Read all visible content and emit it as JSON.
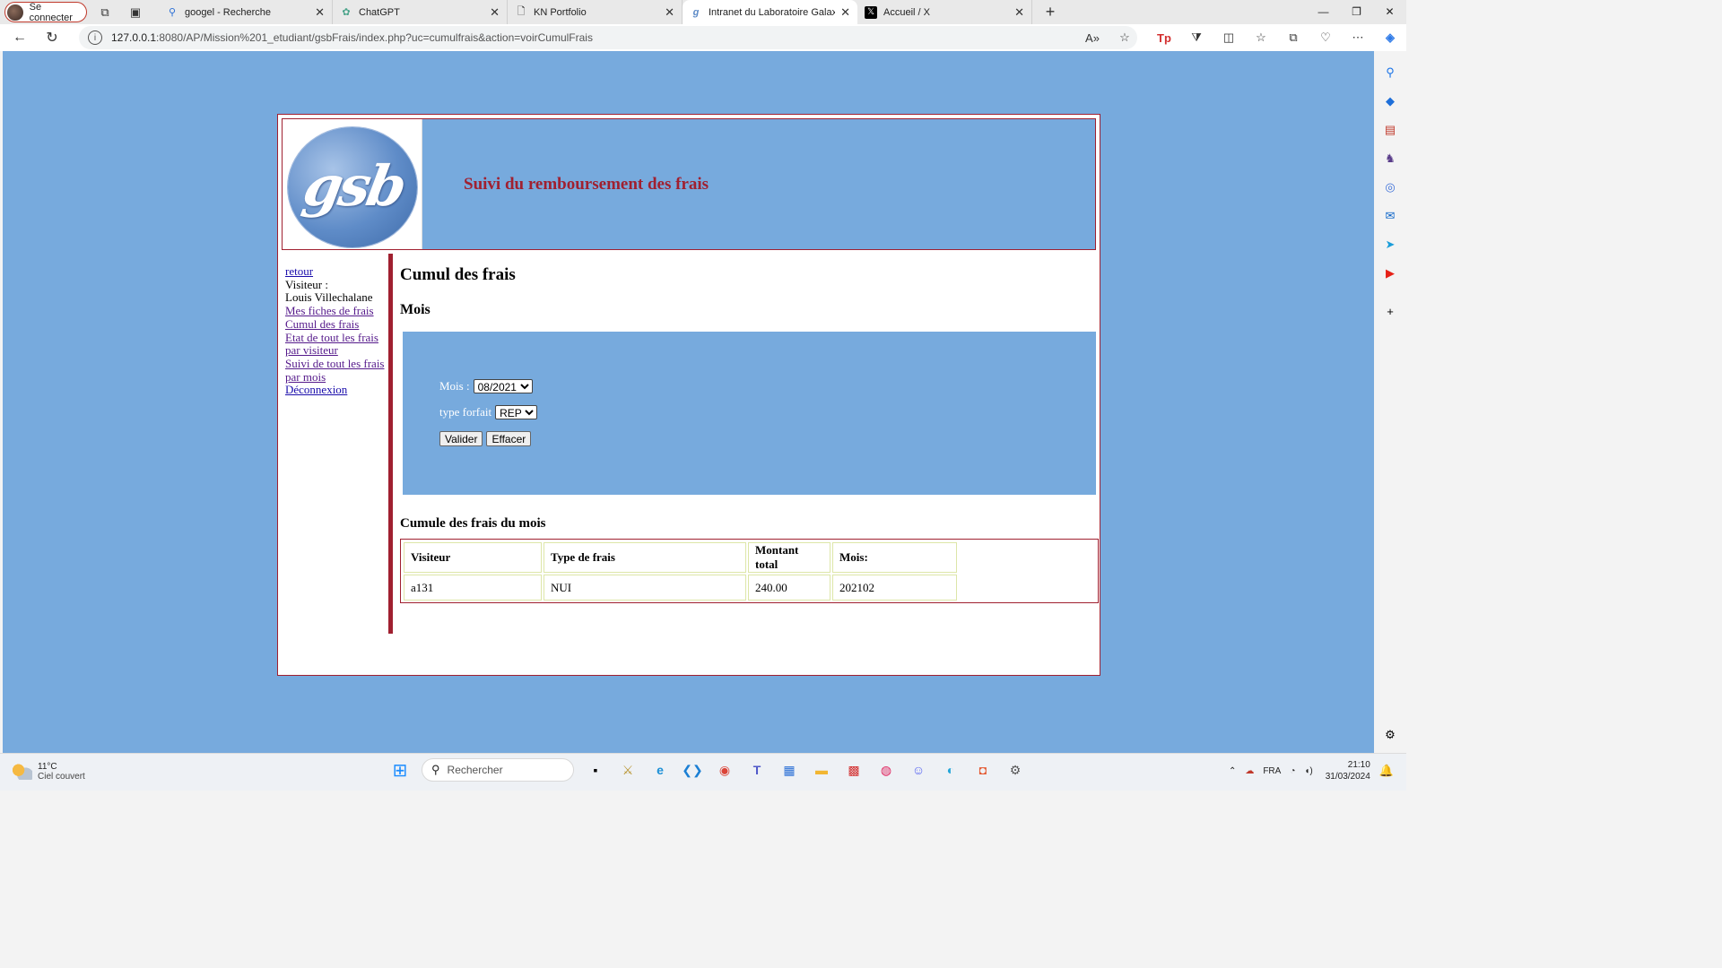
{
  "browser": {
    "profile_label": "Se connecter",
    "tabs": [
      {
        "title": "googel - Recherche",
        "icon": "search-icon"
      },
      {
        "title": "ChatGPT",
        "icon": "chatgpt-icon"
      },
      {
        "title": "KN Portfolio",
        "icon": "document-icon"
      },
      {
        "title": "Intranet du Laboratoire Galaxy-S",
        "icon": "gsb-icon",
        "active": true
      },
      {
        "title": "Accueil / X",
        "icon": "x-icon"
      }
    ],
    "url_host": "127.0.0.1",
    "url_path": ":8080/AP/Mission%201_etudiant/gsbFrais/index.php?uc=cumulfrais&action=voirCumulFrais"
  },
  "header": {
    "logo_text": "gsb",
    "title": "Suivi du remboursement des frais"
  },
  "menu": {
    "retour": "retour",
    "visiteur_label": "Visiteur :",
    "visiteur_name": "Louis Villechalane",
    "mes_fiches": "Mes fiches de frais",
    "cumul": "Cumul des frais",
    "etat_l1": "Etat de tout les frais",
    "etat_l2": "par visiteur",
    "suivi_l1": "Suivi de tout les frais",
    "suivi_l2": "par mois",
    "deconnexion": "Déconnexion"
  },
  "content": {
    "title": "Cumul des frais",
    "section_mois": "Mois",
    "form": {
      "mois_label": "Mois :",
      "mois_value": "08/2021",
      "type_label": "type forfait",
      "type_value": "REP",
      "valider": "Valider",
      "effacer": "Effacer"
    },
    "section_cumul": "Cumule des frais du mois",
    "table": {
      "headers": [
        "Visiteur",
        "Type de frais",
        "Montant total",
        "Mois:"
      ],
      "rows": [
        [
          "a131",
          "NUI",
          "240.00",
          "202102"
        ]
      ]
    }
  },
  "taskbar": {
    "temperature": "11°C",
    "weather": "Ciel couvert",
    "search_placeholder": "Rechercher",
    "language": "FRA",
    "time": "21:10",
    "date": "31/03/2024"
  }
}
